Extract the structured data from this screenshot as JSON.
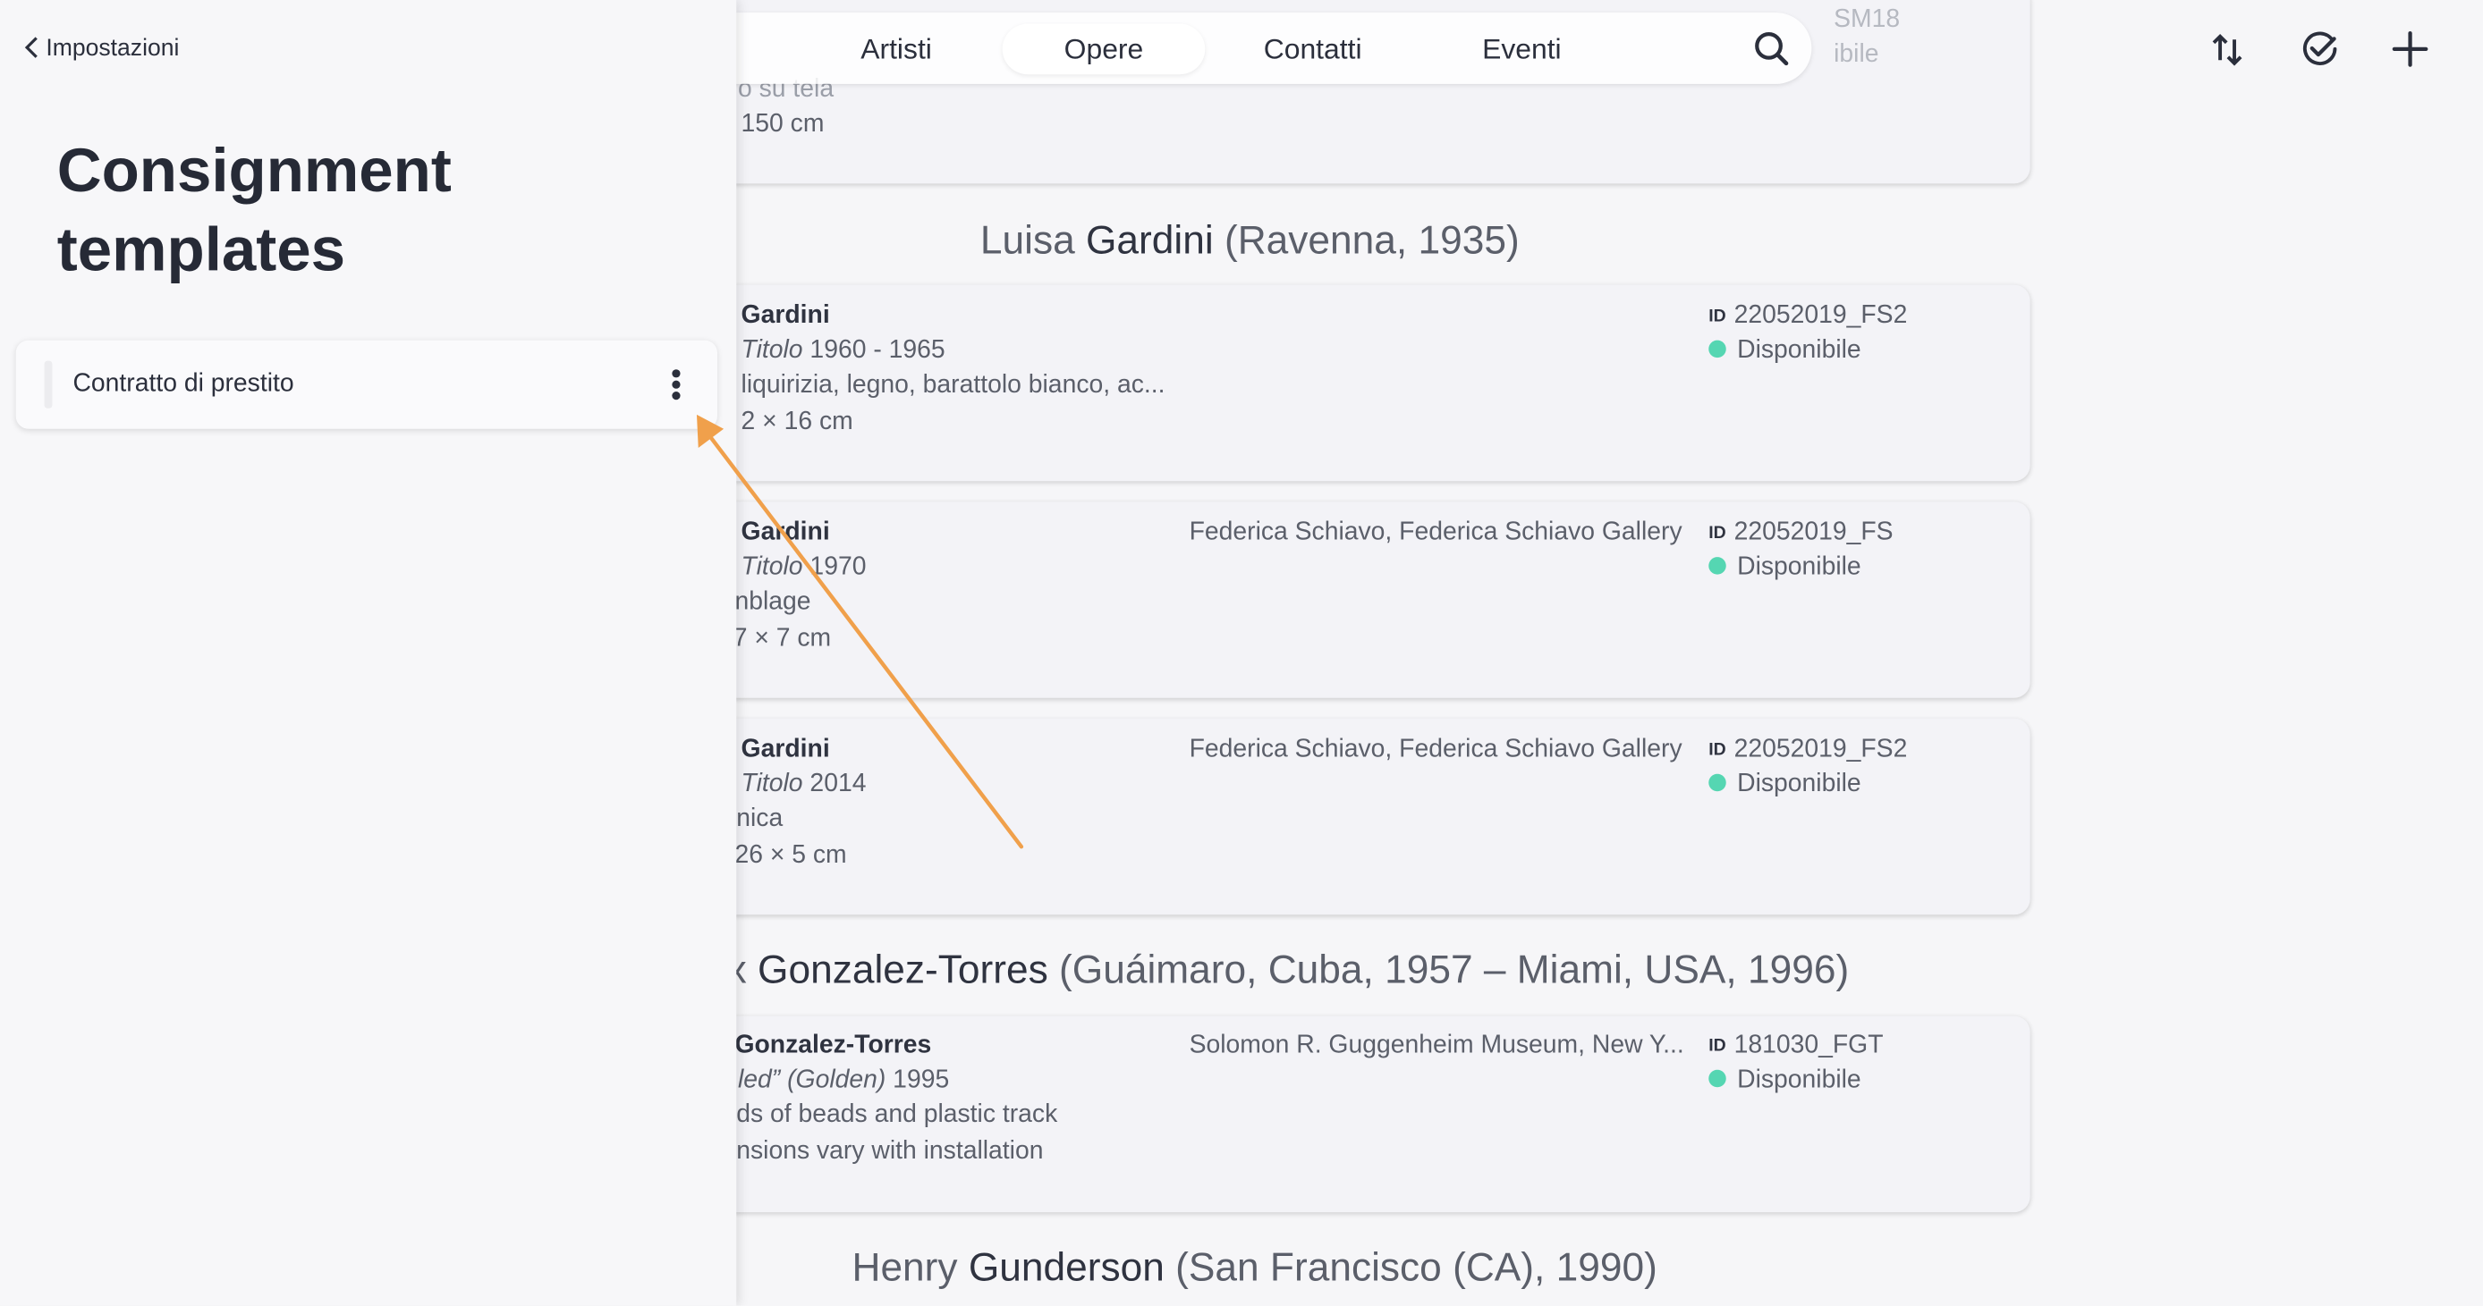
{
  "nav": {
    "tabs": [
      "Artisti",
      "Opere",
      "Contatti",
      "Eventi"
    ],
    "active_tab": "Opere"
  },
  "top_partial": {
    "line1": "o su tela",
    "line2": "150 cm",
    "id_fragment": "SM18",
    "status_fragment": "ibile"
  },
  "artists": [
    {
      "first_name": "Luisa ",
      "last_name": "Gardini",
      "details": " (Ravenna, 1935)",
      "works": [
        {
          "artist": "Gardini",
          "title": "Titolo",
          "year": " 1960 - 1965",
          "medium": "liquirizia, legno, barattolo bianco, ac...",
          "dimensions": "2 × 16 cm",
          "owner": "",
          "id_label": "ID",
          "id": "22052019_FS2",
          "status": "Disponibile"
        },
        {
          "artist": "Gardini",
          "title": "Titolo",
          "year": " 1970",
          "medium": "nblage",
          "dimensions": "7 × 7 cm",
          "owner": "Federica Schiavo, Federica Schiavo Gallery",
          "id_label": "ID",
          "id": "22052019_FS",
          "status": "Disponibile"
        },
        {
          "artist": "Gardini",
          "title": "Titolo",
          "year": " 2014",
          "medium": "nica",
          "dimensions": "26 × 5 cm",
          "owner": "Federica Schiavo, Federica Schiavo Gallery",
          "id_label": "ID",
          "id": "22052019_FS2",
          "status": "Disponibile"
        }
      ]
    },
    {
      "first_name": "x ",
      "last_name": "Gonzalez-Torres",
      "details": " (Guáimaro, Cuba, 1957 – Miami, USA, 1996)",
      "works": [
        {
          "artist": "Gonzalez-Torres",
          "title": "led” (Golden)",
          "year": " 1995",
          "medium": "ds of beads and plastic track",
          "dimensions": "nsions vary with installation",
          "owner": "Solomon R. Guggenheim Museum, New Y...",
          "id_label": "ID",
          "id": "181030_FGT",
          "status": "Disponibile"
        }
      ]
    },
    {
      "first_name": "Henry ",
      "last_name": "Gunderson",
      "details": " (San Francisco (CA), 1990)",
      "works": []
    }
  ],
  "sidebar": {
    "back_label": "Impostazioni",
    "title": "Consignment templates",
    "templates": [
      {
        "name": "Contratto di prestito"
      }
    ]
  },
  "colors": {
    "status_available": "#55d6b2",
    "annotation_arrow": "#f0a04b"
  },
  "icons": [
    "search-icon",
    "sort-icon",
    "check-circle-icon",
    "plus-icon",
    "more-vertical-icon",
    "chevron-left-icon"
  ]
}
